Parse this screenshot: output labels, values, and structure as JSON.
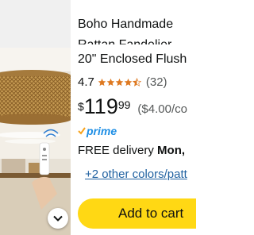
{
  "product": {
    "title_line1": "Boho Handmade",
    "title_line2": "Rattan Fandelier",
    "title_line3": "20\" Enclosed Flush",
    "rating": "4.7",
    "review_count": "(32)",
    "stars_filled": 4.5,
    "price_symbol": "$",
    "price_dollars": "119",
    "price_cents": "99",
    "unit_price": "($4.00/co",
    "prime_label": "prime",
    "delivery_prefix": "FREE delivery",
    "delivery_date": "Mon,",
    "other_colors": "+2 other colors/patt",
    "add_to_cart": "Add to cart"
  },
  "colors": {
    "cart_button": "#ffd814",
    "link": "#2162a1",
    "star": "#de7921",
    "prime": "#1f8fe5"
  },
  "icons": {
    "expand": "chevron-down-icon",
    "prime_check": "check-icon",
    "star": "star-icon"
  }
}
